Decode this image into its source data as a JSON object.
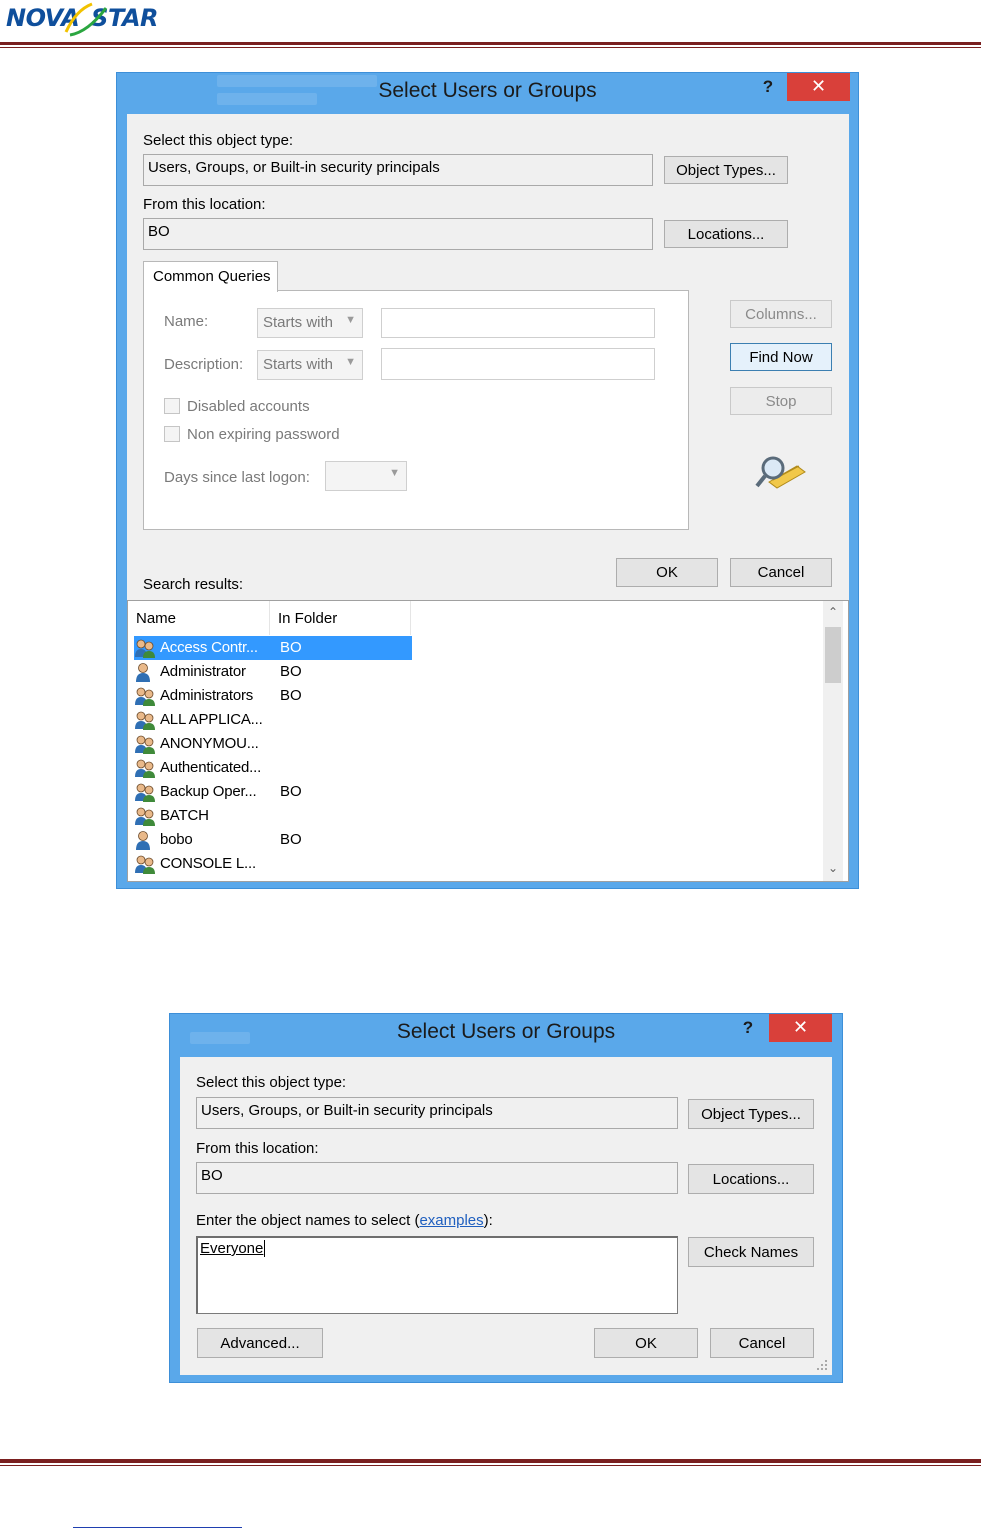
{
  "header": {
    "logo_left": "NOVA",
    "logo_right": "STAR",
    "brand_color": "#0f4f9c",
    "rule_color": "#7a1f1f"
  },
  "dialog1": {
    "title": "Select Users or Groups",
    "help_label": "?",
    "close_label": "✕",
    "object_type_label": "Select this object type:",
    "object_type_value": "Users, Groups, or Built-in security principals",
    "object_types_button": "Object Types...",
    "location_label": "From this location:",
    "location_value": "BO",
    "locations_button": "Locations...",
    "tab_label": "Common Queries",
    "name_label": "Name:",
    "name_combo": "Starts with",
    "description_label": "Description:",
    "description_combo": "Starts with",
    "disabled_accounts": "Disabled accounts",
    "non_expiring": "Non expiring password",
    "days_since_label": "Days since last logon:",
    "columns_button": "Columns...",
    "find_now_button": "Find Now",
    "stop_button": "Stop",
    "ok_button": "OK",
    "cancel_button": "Cancel",
    "search_results_label": "Search results:",
    "columns": [
      "Name",
      "In Folder"
    ],
    "rows": [
      {
        "name": "Access Contr...",
        "folder": "BO",
        "icon": "group-icon",
        "selected": true
      },
      {
        "name": "Administrator",
        "folder": "BO",
        "icon": "user-icon",
        "selected": false
      },
      {
        "name": "Administrators",
        "folder": "BO",
        "icon": "group-icon",
        "selected": false
      },
      {
        "name": "ALL APPLICA...",
        "folder": "",
        "icon": "group-icon",
        "selected": false
      },
      {
        "name": "ANONYMOU...",
        "folder": "",
        "icon": "group-icon",
        "selected": false
      },
      {
        "name": "Authenticated...",
        "folder": "",
        "icon": "group-icon",
        "selected": false
      },
      {
        "name": "Backup Oper...",
        "folder": "BO",
        "icon": "group-icon",
        "selected": false
      },
      {
        "name": "BATCH",
        "folder": "",
        "icon": "group-icon",
        "selected": false
      },
      {
        "name": "bobo",
        "folder": "BO",
        "icon": "user-icon",
        "selected": false
      },
      {
        "name": "CONSOLE L...",
        "folder": "",
        "icon": "group-icon",
        "selected": false
      }
    ]
  },
  "dialog2": {
    "title": "Select Users or Groups",
    "help_label": "?",
    "close_label": "✕",
    "object_type_label": "Select this object type:",
    "object_type_value": "Users, Groups, or Built-in security principals",
    "object_types_button": "Object Types...",
    "location_label": "From this location:",
    "location_value": "BO",
    "locations_button": "Locations...",
    "enter_label_prefix": "Enter the object names to select (",
    "examples_link": "examples",
    "enter_label_suffix": "):",
    "names_value": "Everyone",
    "check_names_button": "Check Names",
    "advanced_button": "Advanced...",
    "ok_button": "OK",
    "cancel_button": "Cancel"
  }
}
